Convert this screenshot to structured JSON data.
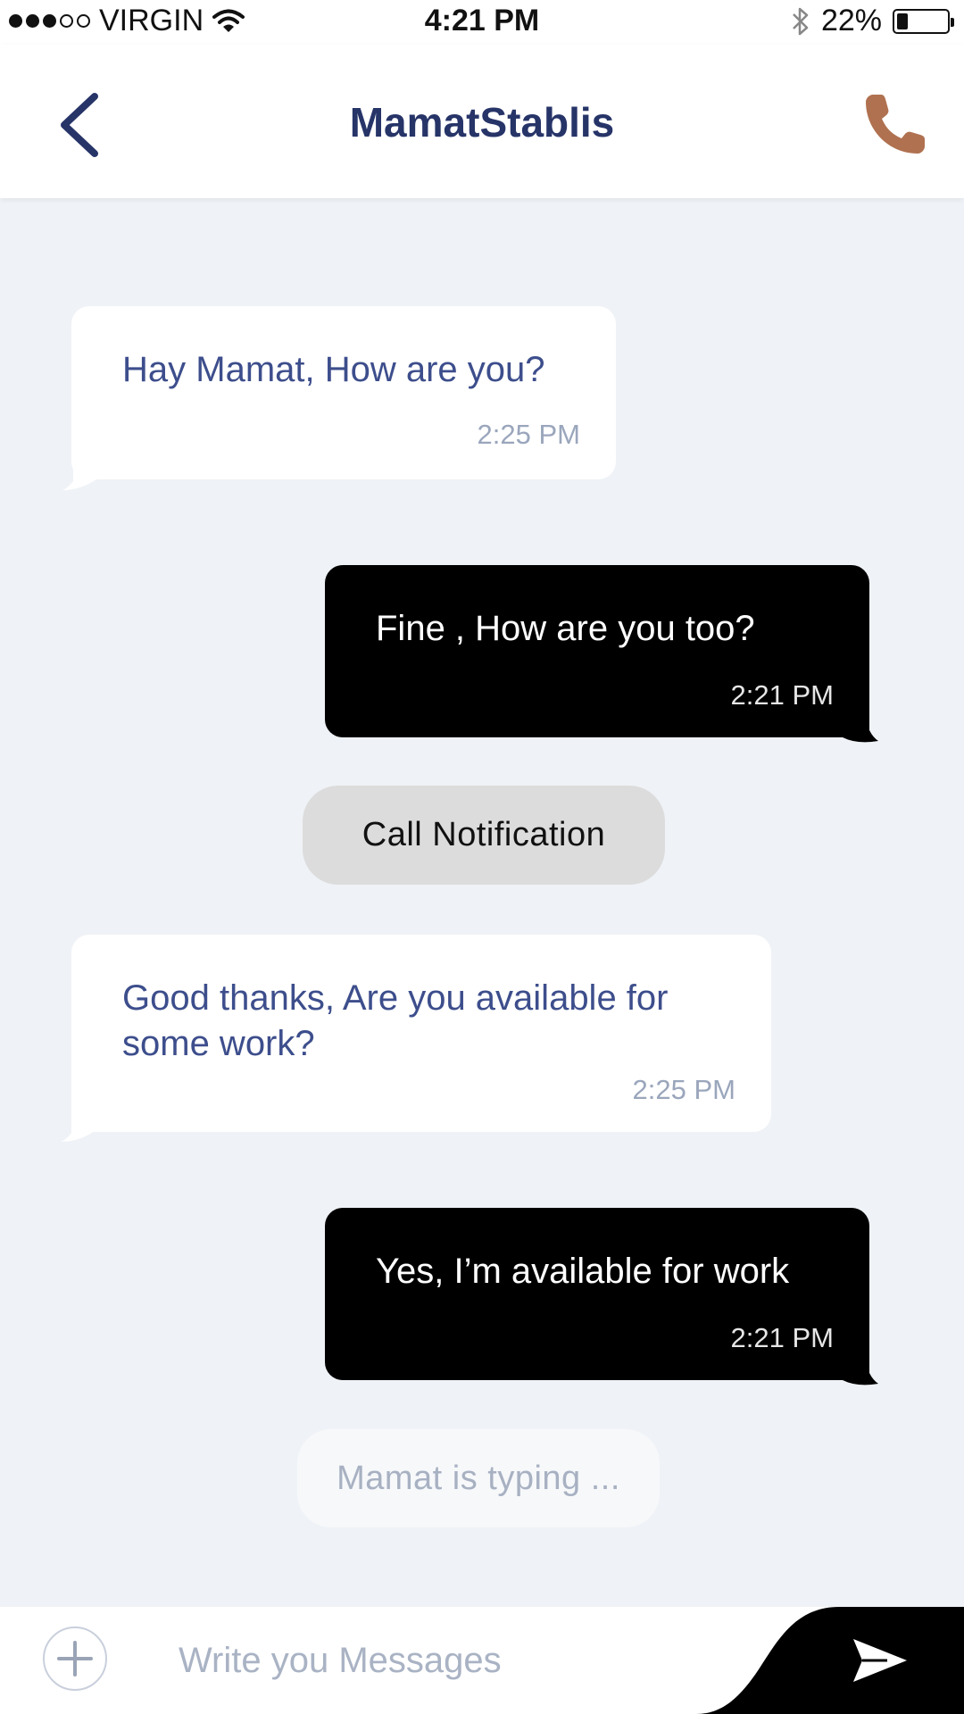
{
  "status_bar": {
    "carrier": "VIRGIN",
    "time": "4:21 PM",
    "battery": "22%",
    "battery_level": 0.22,
    "signal_icon": "signal-dots-icon",
    "wifi_icon": "wifi-icon",
    "bluetooth_icon": "bluetooth-icon"
  },
  "header": {
    "title": "MamatStablis",
    "back_icon": "chevron-left-icon",
    "call_icon": "phone-icon",
    "title_color": "#263468",
    "call_icon_color": "#b07150"
  },
  "messages": [
    {
      "direction": "incoming",
      "text": "Hay Mamat, How are you?",
      "time": "2:25 PM"
    },
    {
      "direction": "outgoing",
      "text": "Fine , How are you too?",
      "time": "2:21 PM"
    },
    {
      "direction": "incoming",
      "text": "Good thanks, Are you available for some work?",
      "time": "2:25 PM"
    },
    {
      "direction": "outgoing",
      "text": "Yes, I’m available for work",
      "time": "2:21 PM"
    }
  ],
  "call_notification": "Call Notification",
  "typing_indicator": "Mamat is typing ...",
  "composer": {
    "placeholder": "Write you Messages",
    "add_icon": "plus-icon",
    "send_icon": "send-icon"
  },
  "colors": {
    "background": "#eff2f6",
    "incoming_bubble": "#ffffff",
    "incoming_text": "#3d4e8c",
    "outgoing_bubble": "#000000",
    "outgoing_text": "#ffffff"
  }
}
